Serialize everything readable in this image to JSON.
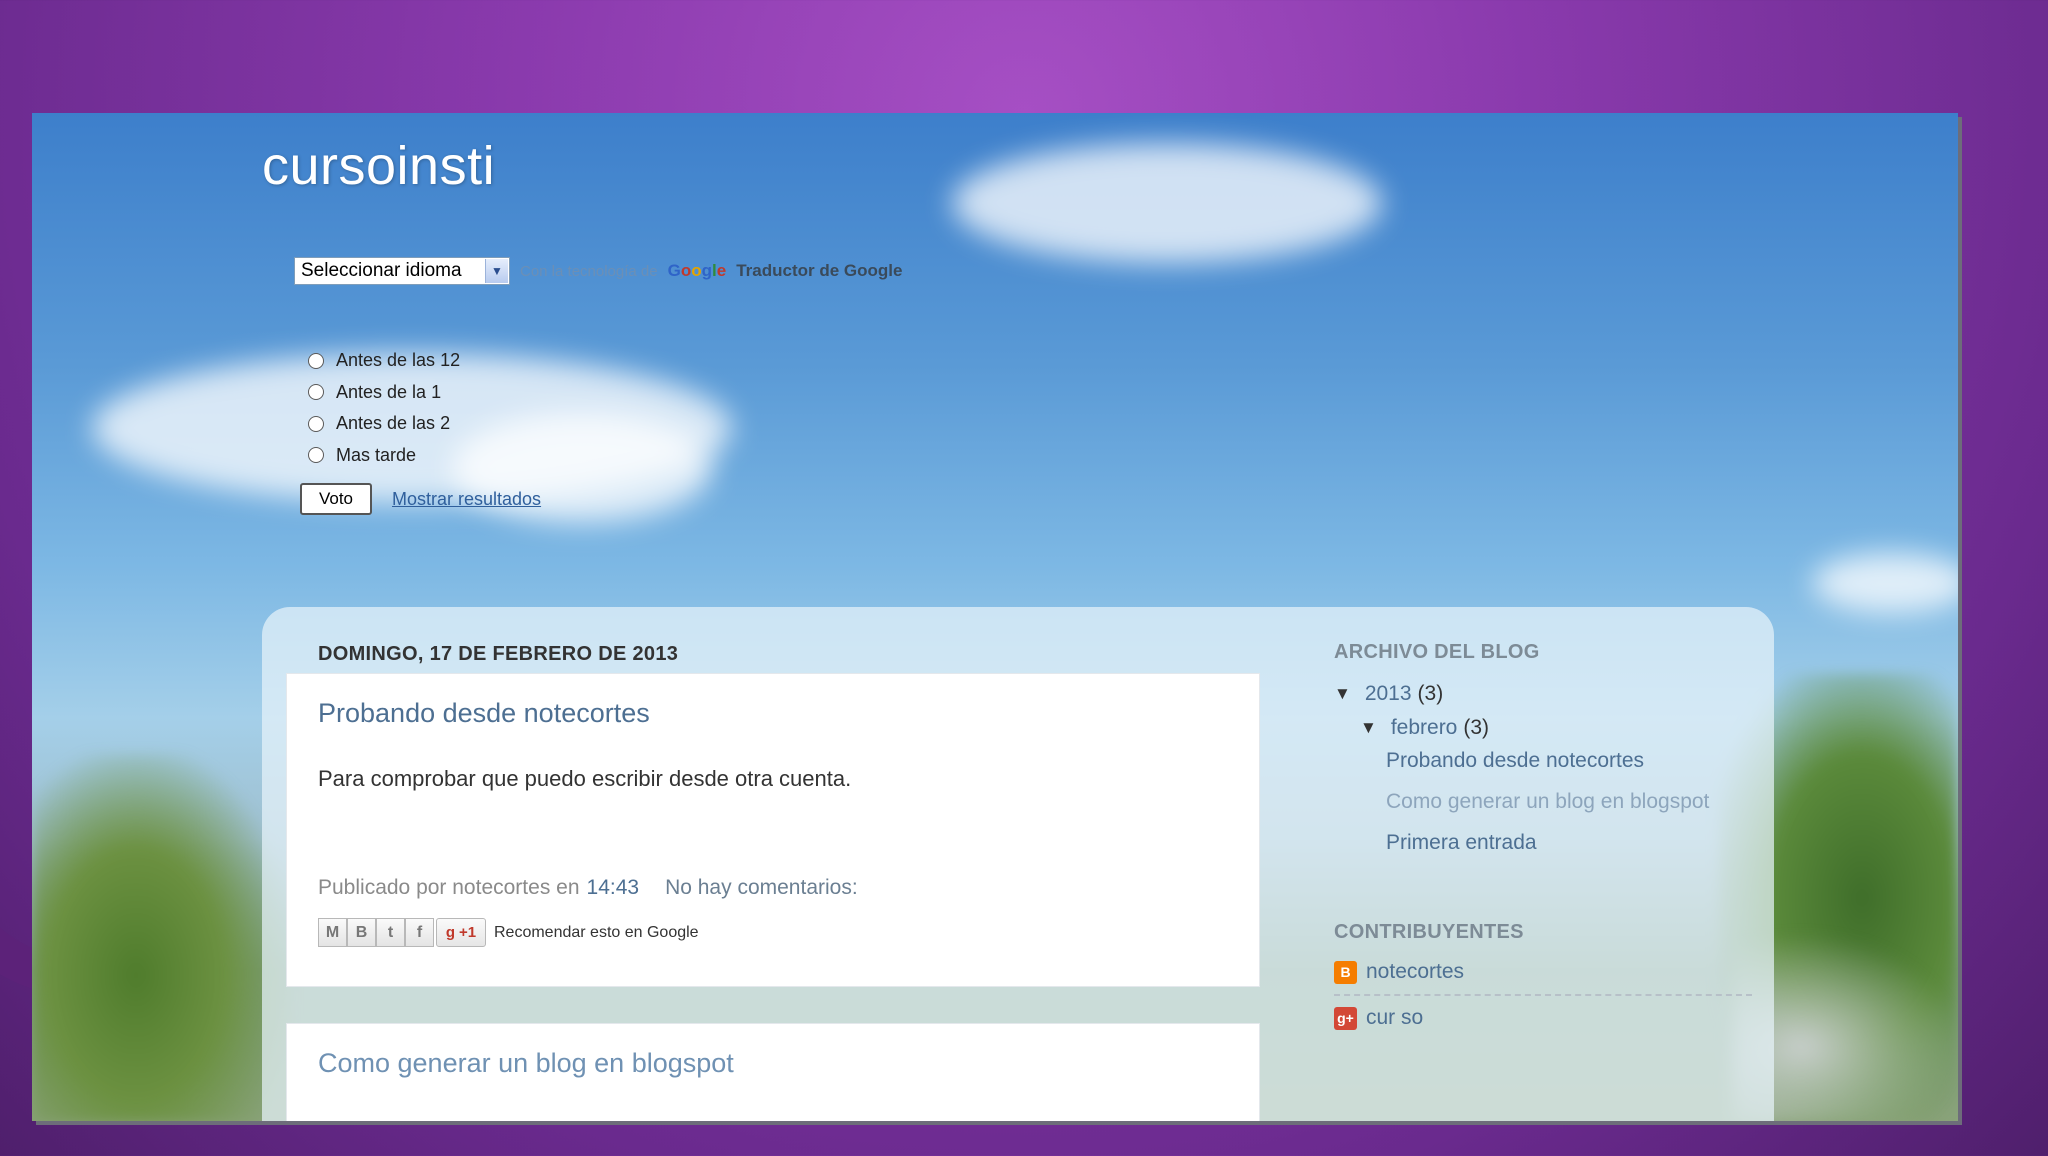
{
  "blog": {
    "title": "cursoinsti"
  },
  "translate": {
    "select_value": "Seleccionar idioma",
    "powered_prefix": "Con la tecnología de",
    "google": [
      "G",
      "o",
      "o",
      "g",
      "l",
      "e"
    ],
    "translator": "Traductor de Google"
  },
  "poll": {
    "options": [
      "Antes de las 12",
      "Antes de la 1",
      "Antes de las 2",
      "Mas tarde"
    ],
    "vote_label": "Voto",
    "results_link": "Mostrar resultados"
  },
  "post1": {
    "date": "DOMINGO, 17 DE FEBRERO DE 2013",
    "title": "Probando desde notecortes",
    "body": "Para comprobar que puedo escribir desde otra cuenta.",
    "byline": "Publicado por notecortes en",
    "time": "14:43",
    "comments": "No hay comentarios:",
    "share_icons": [
      "email-icon",
      "blogger-icon",
      "twitter-icon",
      "facebook-icon"
    ],
    "plusone_label": "+1",
    "recommend": "Recomendar esto en Google"
  },
  "post2": {
    "title": "Como generar un blog en blogspot"
  },
  "sidebar": {
    "archive_heading": "ARCHIVO DEL BLOG",
    "year": "2013",
    "year_count": "(3)",
    "month": "febrero",
    "month_count": "(3)",
    "posts": [
      "Probando desde notecortes",
      "Como generar un blog en blogspot",
      "Primera entrada"
    ],
    "contributors_heading": "CONTRIBUYENTES",
    "contributors": [
      "notecortes",
      "cur so"
    ]
  },
  "colors": {
    "link": "#4d6f92",
    "purple_bg": "#8a3aad",
    "sky": "#5a9ad6"
  }
}
